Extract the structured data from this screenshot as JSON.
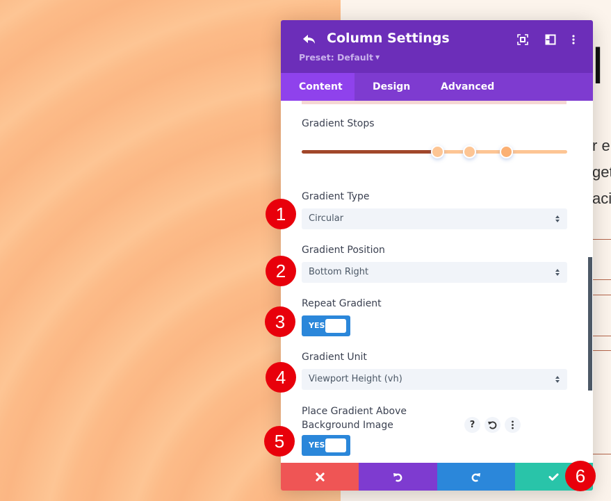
{
  "modal": {
    "title": "Column Settings",
    "preset": "Preset: Default",
    "tabs": [
      {
        "label": "Content",
        "active": true
      },
      {
        "label": "Design",
        "active": false
      },
      {
        "label": "Advanced",
        "active": false
      }
    ],
    "header_icons": [
      "back-icon",
      "fullscreen-icon",
      "sidebar-layout-icon",
      "more-options-icon"
    ]
  },
  "fields": {
    "gradient_stops": {
      "label": "Gradient Stops",
      "stops": [
        {
          "position_pct": 51,
          "color": "#fdc594"
        },
        {
          "position_pct": 63,
          "color": "#fdc594"
        },
        {
          "position_pct": 77,
          "color": "#fbb073"
        }
      ],
      "track_colors": {
        "start": "#a1472a",
        "end": "#fdc594"
      }
    },
    "gradient_type": {
      "label": "Gradient Type",
      "value": "Circular"
    },
    "gradient_position": {
      "label": "Gradient Position",
      "value": "Bottom Right"
    },
    "repeat_gradient": {
      "label": "Repeat Gradient",
      "value": "YES"
    },
    "gradient_unit": {
      "label": "Gradient Unit",
      "value": "Viewport Height (vh)"
    },
    "place_above": {
      "label_line1": "Place Gradient Above",
      "label_line2": "Background Image",
      "value": "YES",
      "row_icons": {
        "help": "?",
        "reset": "reset-icon",
        "more": "more-icon"
      }
    }
  },
  "footer": {
    "buttons": [
      {
        "name": "cancel",
        "icon": "close-icon",
        "color": "#ef5555"
      },
      {
        "name": "undo",
        "icon": "undo-icon",
        "color": "#7e3bd0"
      },
      {
        "name": "redo",
        "icon": "redo-icon",
        "color": "#2b87da"
      },
      {
        "name": "save",
        "icon": "check-icon",
        "color": "#29c4a9"
      }
    ]
  },
  "badges": [
    "1",
    "2",
    "3",
    "4",
    "5",
    "6"
  ],
  "page": {
    "heading_fragment": "l",
    "lines": [
      "r e",
      "get",
      "aci"
    ]
  }
}
